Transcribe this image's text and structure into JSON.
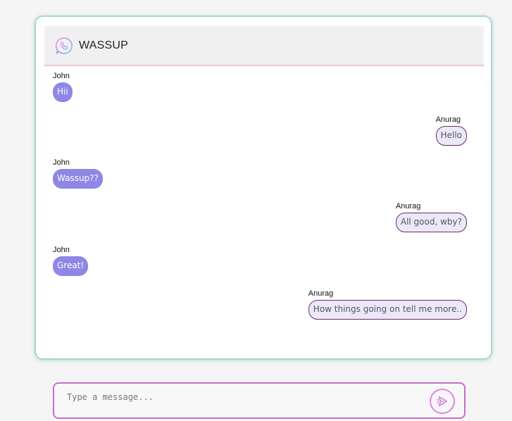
{
  "header": {
    "title": "WASSUP",
    "logo_icon": "chat-phone-logo-icon"
  },
  "messages": [
    {
      "sender": "John",
      "text": "Hii",
      "direction": "incoming"
    },
    {
      "sender": "Anurag",
      "text": "Hello",
      "direction": "outgoing"
    },
    {
      "sender": "John",
      "text": "Wassup??",
      "direction": "incoming"
    },
    {
      "sender": "Anurag",
      "text": "All good, wby?",
      "direction": "outgoing"
    },
    {
      "sender": "John",
      "text": "Great!",
      "direction": "incoming"
    },
    {
      "sender": "Anurag",
      "text": "How things going on tell me more..",
      "direction": "outgoing"
    }
  ],
  "composer": {
    "placeholder": "Type a message...",
    "value": "",
    "send_icon": "send-icon"
  },
  "colors": {
    "incoming_bubble": "#8e87e6",
    "outgoing_bubble": "#ebe8f8",
    "outgoing_border": "#6b2d6a",
    "card_border": "#a9d6d2",
    "composer_border": "#c36fc6",
    "header_divider": "#f0bfd8"
  }
}
